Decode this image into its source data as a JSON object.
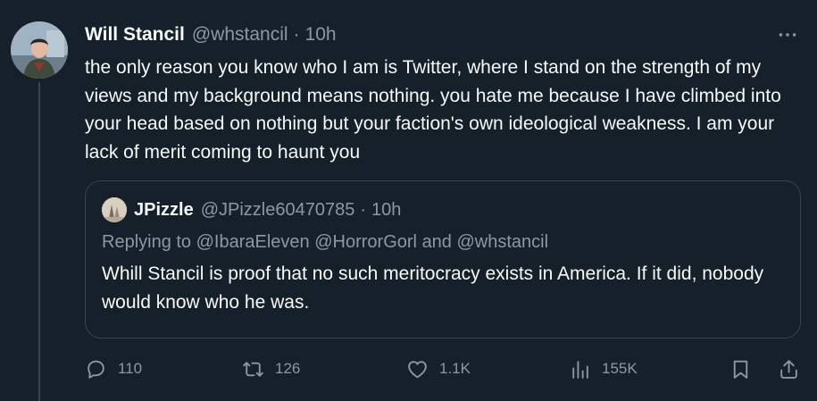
{
  "tweet": {
    "author_name": "Will Stancil",
    "author_handle": "@whstancil",
    "separator": "·",
    "time": "10h",
    "text": "the only reason you know who I am is Twitter, where I stand on the strength of my views and my background means nothing. you hate me because I have climbed into your head based on nothing but your faction's own ideological weakness. I am your lack of merit coming to haunt you"
  },
  "quoted": {
    "author_name": "JPizzle",
    "author_handle": "@JPizzle60470785",
    "separator": "·",
    "time": "10h",
    "reply_prefix": "Replying to",
    "mention_1": "@IbaraEleven",
    "mention_2": "@HorrorGorl",
    "reply_and": "and",
    "mention_3": "@whstancil",
    "text": "Whill Stancil is proof that no such meritocracy exists in America. If it did, nobody would know who he was."
  },
  "actions": {
    "replies": "110",
    "reposts": "126",
    "likes": "1.1K",
    "views": "155K"
  },
  "icons": {
    "more": "more-horizontal-icon",
    "reply": "reply-icon",
    "repost": "repost-icon",
    "like": "heart-icon",
    "views": "views-chart-icon",
    "bookmark": "bookmark-icon",
    "share": "share-icon"
  },
  "colors": {
    "background": "#15202b",
    "text_primary": "#f7f9f9",
    "text_secondary": "#8b98a5",
    "border": "#38444d"
  }
}
